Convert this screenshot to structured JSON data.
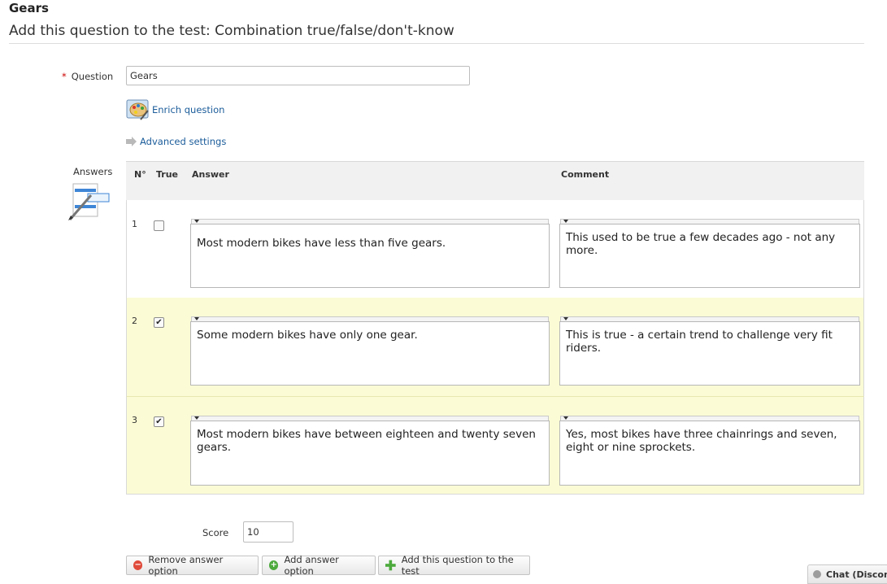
{
  "page": {
    "title": "Gears",
    "subtitle": "Add this question to the test: Combination true/false/don't-know"
  },
  "form": {
    "question_label": "Question",
    "question_required_mark": "*",
    "question_value": "Gears",
    "enrich_label": "Enrich question",
    "advanced_label": "Advanced settings",
    "answers_label": "Answers",
    "score_label": "Score",
    "score_value": "10"
  },
  "table": {
    "headers": {
      "number": "N°",
      "true": "True",
      "answer": "Answer",
      "comment": "Comment"
    },
    "rows": [
      {
        "number": "1",
        "checked": false,
        "answer": "Most modern bikes have less than five gears.",
        "comment": "This used to be true a few decades ago - not any more."
      },
      {
        "number": "2",
        "checked": true,
        "answer": "Some modern bikes have only one gear.",
        "comment": "This is true - a certain trend to challenge very fit riders."
      },
      {
        "number": "3",
        "checked": true,
        "answer": "Most modern bikes have between eighteen and twenty seven gears.",
        "comment": "Yes, most bikes have three chainrings and seven, eight or nine sprockets."
      }
    ]
  },
  "buttons": {
    "remove": "Remove answer option",
    "add": "Add answer option",
    "add_to_test": "Add this question to the test"
  },
  "chat": {
    "label": "Chat (Discon"
  },
  "icons": {
    "enrich": "palette-icon",
    "advanced": "arrow-right-icon",
    "answers": "answers-edit-icon",
    "remove": "minus-circle-icon",
    "add": "plus-circle-icon",
    "add_to_test": "green-plus-icon",
    "chat": "status-dot-icon"
  },
  "colors": {
    "link": "#1b5c9a",
    "required": "#cc0000",
    "highlight_row": "#fbfbd5",
    "remove_icon": "#e04b3b",
    "add_icon": "#4caa3c"
  }
}
